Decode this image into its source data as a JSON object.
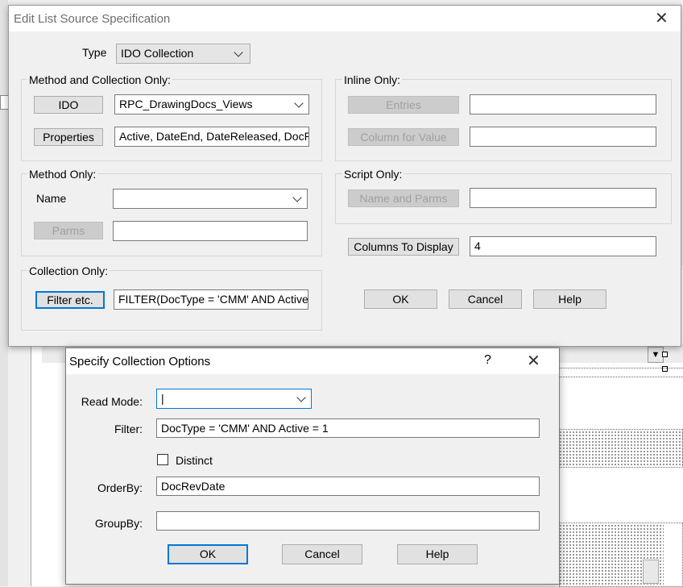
{
  "main_dialog": {
    "title": "Edit List Source Specification",
    "type_label": "Type",
    "type_value": "IDO Collection",
    "method_collection": {
      "label": "Method and Collection Only:",
      "ido_button": "IDO",
      "ido_value": "RPC_DrawingDocs_Views",
      "properties_button": "Properties",
      "properties_value": "Active, DateEnd, DateReleased, DocRe"
    },
    "inline": {
      "label": "Inline Only:",
      "entries_button": "Entries",
      "entries_value": "",
      "column_value_button": "Column for Value",
      "column_value_value": ""
    },
    "method_only": {
      "label": "Method Only:",
      "name_label": "Name",
      "name_value": "",
      "parms_button": "Parms",
      "parms_value": ""
    },
    "script_only": {
      "label": "Script Only:",
      "name_parms_button": "Name and Parms",
      "name_parms_value": ""
    },
    "columns_display_button": "Columns To Display",
    "columns_display_value": "4",
    "collection_only": {
      "label": "Collection Only:",
      "filter_button": "Filter etc.",
      "filter_value": "FILTER(DocType = 'CMM' AND Active"
    },
    "ok_label": "OK",
    "cancel_label": "Cancel",
    "help_label": "Help",
    "close_icon": "close-icon"
  },
  "sub_dialog": {
    "title": "Specify Collection Options",
    "help_glyph": "?",
    "read_mode_label": "Read Mode:",
    "read_mode_value": "|",
    "filter_label": "Filter:",
    "filter_value": "DocType = 'CMM' AND Active = 1",
    "distinct_label": "Distinct",
    "distinct_checked": false,
    "orderby_label": "OrderBy:",
    "orderby_value": "DocRevDate",
    "groupby_label": "GroupBy:",
    "groupby_value": "",
    "ok_label": "OK",
    "cancel_label": "Cancel",
    "help_label": "Help"
  },
  "colors": {
    "dialog_bg": "#f0f0f0",
    "focus_border": "#0078d7",
    "disabled_text": "#a0a0a0"
  }
}
